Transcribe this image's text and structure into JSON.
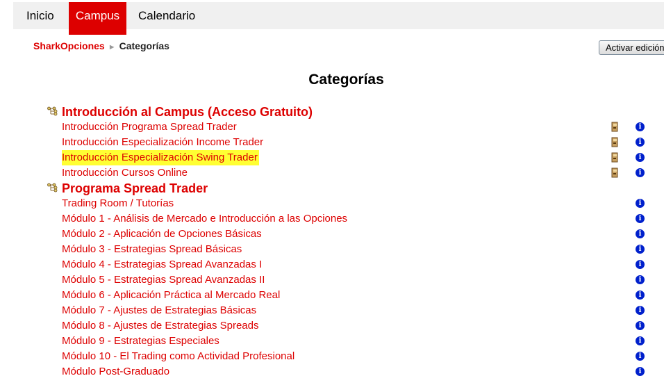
{
  "nav": {
    "items": [
      {
        "label": "Inicio"
      },
      {
        "label": "Campus"
      },
      {
        "label": "Calendario"
      }
    ],
    "active": "Campus"
  },
  "breadcrumb": {
    "home": "SharkOpciones",
    "separator": "►",
    "current": "Categorías"
  },
  "edit_button": "Activar edición",
  "title": "Categorías",
  "categories": [
    {
      "name": "Introducción al Campus (Acceso Gratuito)",
      "courses": [
        {
          "name": "Introducción Programa Spread Trader",
          "guest_access": true,
          "info": "i"
        },
        {
          "name": "Introducción Especialización Income Trader",
          "guest_access": true,
          "info": "i"
        },
        {
          "name": "Introducción Especialización Swing Trader",
          "guest_access": true,
          "info": "i",
          "highlighted": true
        },
        {
          "name": "Introducción Cursos Online",
          "guest_access": true,
          "info": "i"
        }
      ]
    },
    {
      "name": "Programa Spread Trader",
      "courses": [
        {
          "name": "Trading Room / Tutorías",
          "info": "i"
        },
        {
          "name": "Módulo 1 - Análisis de Mercado e Introducción a las Opciones",
          "info": "i"
        },
        {
          "name": "Módulo 2 - Aplicación de Opciones Básicas",
          "info": "i"
        },
        {
          "name": "Módulo 3 - Estrategias Spread Básicas",
          "info": "i"
        },
        {
          "name": "Módulo 4 - Estrategias Spread Avanzadas I",
          "info": "i"
        },
        {
          "name": "Módulo 5 - Estrategias Spread Avanzadas II",
          "info": "i"
        },
        {
          "name": "Módulo 6 - Aplicación Práctica al Mercado Real",
          "info": "i"
        },
        {
          "name": "Módulo 7 - Ajustes de Estrategias Básicas",
          "info": "i"
        },
        {
          "name": "Módulo 8 - Ajustes de Estrategias Spreads",
          "info": "i"
        },
        {
          "name": "Módulo 9 - Estrategias Especiales",
          "info": "i"
        },
        {
          "name": "Módulo 10 - El Trading como Actividad Profesional",
          "info": "i"
        },
        {
          "name": "Módulo Post-Graduado",
          "info": "i"
        }
      ]
    }
  ],
  "colors": {
    "accent": "#dd0000",
    "highlight": "#ffff33",
    "info": "#0020cc",
    "nav_bg": "#f0f0f0"
  },
  "icons": {
    "category": "category-folder-icon",
    "guest_access": "guest-key-icon",
    "info": "info-icon"
  }
}
